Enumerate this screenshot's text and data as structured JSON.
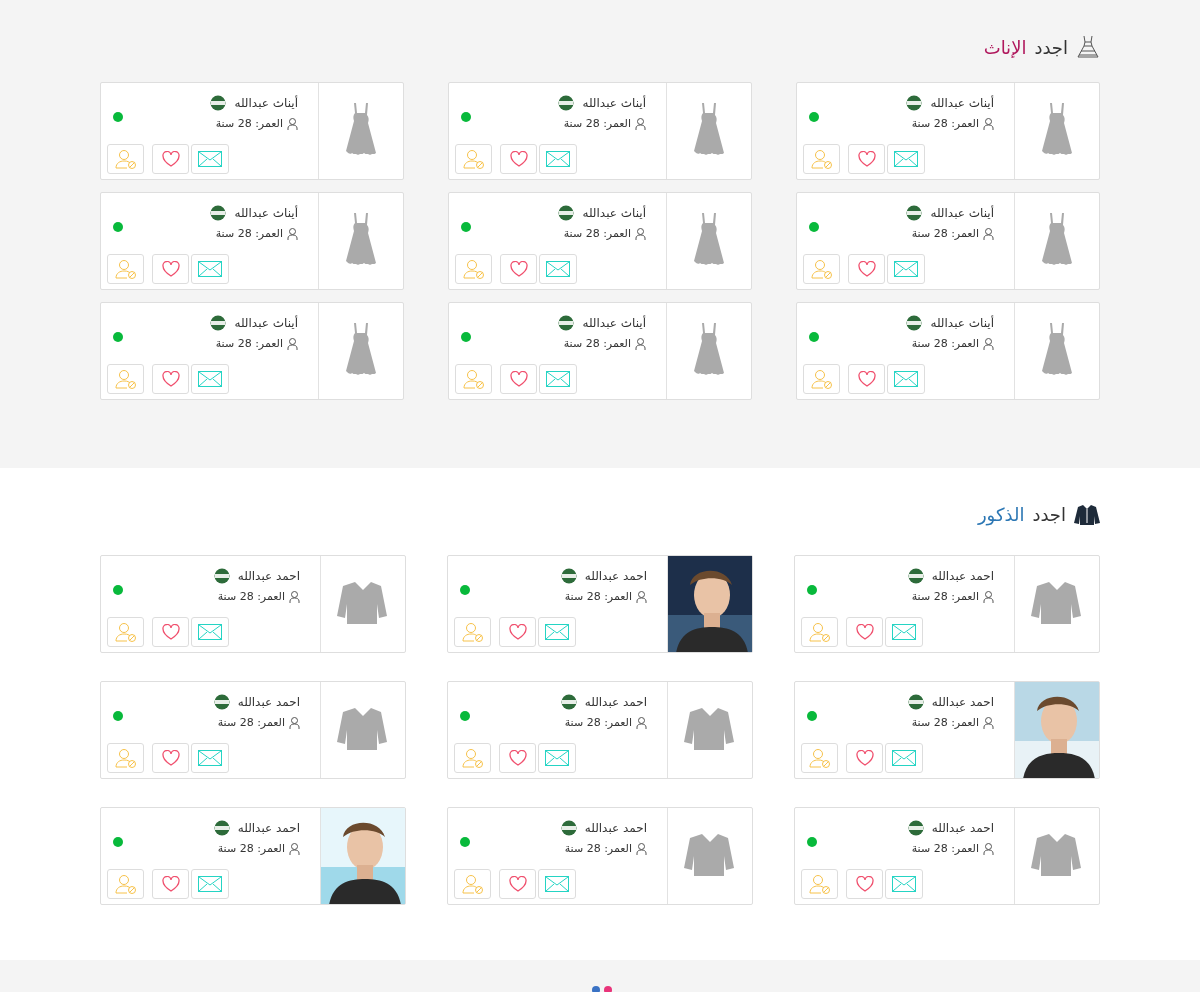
{
  "sections": [
    {
      "kind": "female",
      "title": "اجدد",
      "highlight": "الإناث",
      "cards": [
        {
          "name": "أيناث عبدالله",
          "age": "العمر: 28 سنة",
          "online": true,
          "kind": "dress"
        },
        {
          "name": "أيناث عبدالله",
          "age": "العمر: 28 سنة",
          "online": true,
          "kind": "dress"
        },
        {
          "name": "أيناث عبدالله",
          "age": "العمر: 28 سنة",
          "online": true,
          "kind": "dress"
        },
        {
          "name": "أيناث عبدالله",
          "age": "العمر: 28 سنة",
          "online": true,
          "kind": "dress"
        },
        {
          "name": "أيناث عبدالله",
          "age": "العمر: 28 سنة",
          "online": true,
          "kind": "dress"
        },
        {
          "name": "أيناث عبدالله",
          "age": "العمر: 28 سنة",
          "online": true,
          "kind": "dress"
        },
        {
          "name": "أيناث عبدالله",
          "age": "العمر: 28 سنة",
          "online": true,
          "kind": "dress"
        },
        {
          "name": "أيناث عبدالله",
          "age": "العمر: 28 سنة",
          "online": true,
          "kind": "dress"
        },
        {
          "name": "أيناث عبدالله",
          "age": "العمر: 28 سنة",
          "online": true,
          "kind": "dress"
        }
      ]
    },
    {
      "kind": "male",
      "title": "اجدد",
      "highlight": "الذكور",
      "cards": [
        {
          "name": "احمد عبدالله",
          "age": "العمر: 28 سنة",
          "online": true,
          "kind": "jacket"
        },
        {
          "name": "احمد عبدالله",
          "age": "العمر: 28 سنة",
          "online": true,
          "kind": "picture"
        },
        {
          "name": "احمد عبدالله",
          "age": "العمر: 28 سنة",
          "online": true,
          "kind": "jacket"
        },
        {
          "name": "احمد عبدالله",
          "age": "العمر: 28 سنة",
          "online": true,
          "kind": "picture"
        },
        {
          "name": "احمد عبدالله",
          "age": "العمر: 28 سنة",
          "online": true,
          "kind": "jacket"
        },
        {
          "name": "احمد عبدالله",
          "age": "العمر: 28 سنة",
          "online": true,
          "kind": "jacket"
        },
        {
          "name": "احمد عبدالله",
          "age": "العمر: 28 سنة",
          "online": true,
          "kind": "jacket"
        },
        {
          "name": "احمد عبدالله",
          "age": "العمر: 28 سنة",
          "online": true,
          "kind": "jacket"
        },
        {
          "name": "احمد عبدالله",
          "age": "العمر: 28 سنة",
          "online": true,
          "kind": "picture"
        }
      ]
    }
  ]
}
